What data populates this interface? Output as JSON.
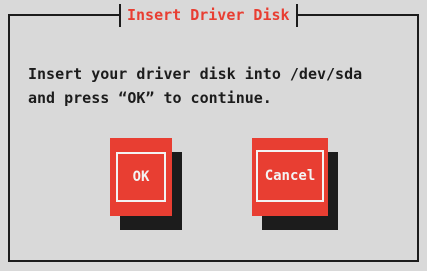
{
  "dialog": {
    "title": "Insert Driver Disk",
    "message_line1": "Insert your driver disk into /dev/sda",
    "message_line2": "and press “OK” to continue."
  },
  "buttons": {
    "ok_label": "OK",
    "cancel_label": "Cancel"
  },
  "colors": {
    "background": "#d9d9d9",
    "accent": "#e83e32",
    "text": "#1c1c1c",
    "button_text": "#f3f3f3"
  }
}
